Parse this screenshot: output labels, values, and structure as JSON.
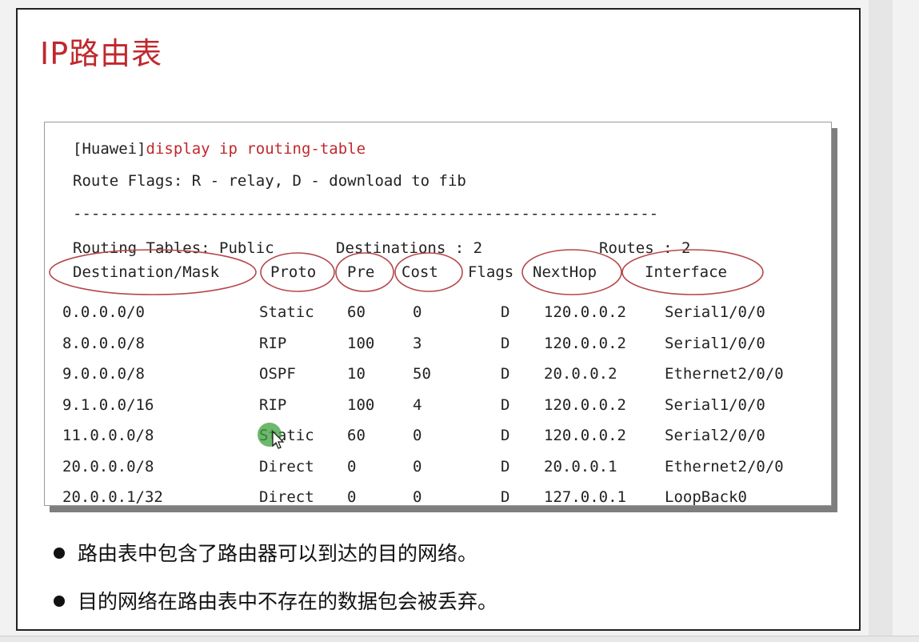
{
  "slide": {
    "title": "IP路由表",
    "accent_color": "#c0282d"
  },
  "terminal": {
    "prompt": "[Huawei]",
    "command": "display ip routing-table",
    "flags_line": "Route Flags: R - relay, D - download to fib",
    "separator": "----------------------------------------------------------------",
    "tables_label": "Routing Tables: Public",
    "destinations_label": "Destinations : 2",
    "routes_label": "Routes : 2",
    "headers": {
      "destination": "Destination/Mask",
      "proto": "Proto",
      "pre": "Pre",
      "cost": "Cost",
      "flags": "Flags",
      "nexthop": "NextHop",
      "interface": "Interface"
    },
    "rows": [
      {
        "destination": "0.0.0.0/0",
        "proto": "Static",
        "pre": "60",
        "cost": "0",
        "flags": "D",
        "nexthop": "120.0.0.2",
        "interface": "Serial1/0/0"
      },
      {
        "destination": "8.0.0.0/8",
        "proto": "RIP",
        "pre": "100",
        "cost": "3",
        "flags": "D",
        "nexthop": "120.0.0.2",
        "interface": "Serial1/0/0"
      },
      {
        "destination": "9.0.0.0/8",
        "proto": "OSPF",
        "pre": "10",
        "cost": "50",
        "flags": "D",
        "nexthop": "20.0.0.2",
        "interface": "Ethernet2/0/0"
      },
      {
        "destination": "9.1.0.0/16",
        "proto": "RIP",
        "pre": "100",
        "cost": "4",
        "flags": "D",
        "nexthop": "120.0.0.2",
        "interface": "Serial1/0/0"
      },
      {
        "destination": "11.0.0.0/8",
        "proto": "Static",
        "pre": "60",
        "cost": "0",
        "flags": "D",
        "nexthop": "120.0.0.2",
        "interface": "Serial2/0/0"
      },
      {
        "destination": "20.0.0.0/8",
        "proto": "Direct",
        "pre": "0",
        "cost": "0",
        "flags": "D",
        "nexthop": "20.0.0.1",
        "interface": "Ethernet2/0/0"
      },
      {
        "destination": "20.0.0.1/32",
        "proto": "Direct",
        "pre": "0",
        "cost": "0",
        "flags": "D",
        "nexthop": "127.0.0.1",
        "interface": "LoopBack0"
      }
    ]
  },
  "bullets": [
    "路由表中包含了路由器可以到达的目的网络。",
    "目的网络在路由表中不存在的数据包会被丢弃。"
  ]
}
